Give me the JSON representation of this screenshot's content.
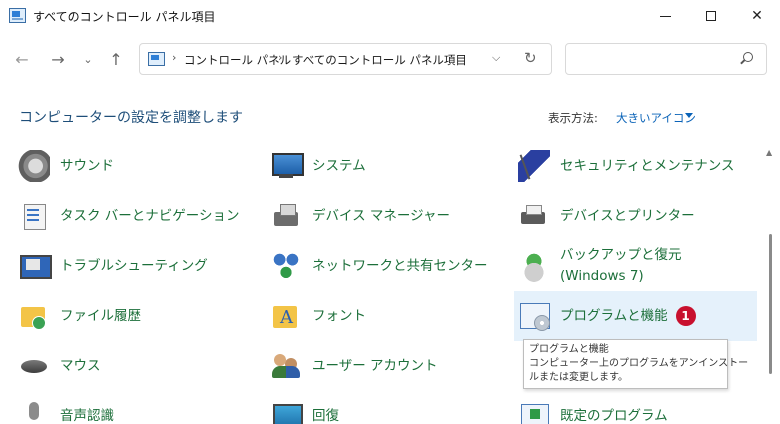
{
  "window": {
    "title": "すべてのコントロール パネル項目"
  },
  "nav": {
    "back_icon": "arrow-left",
    "forward_icon": "arrow-right",
    "recent_icon": "chevron-down",
    "up_icon": "arrow-up"
  },
  "address": {
    "crumbs": [
      "コントロール パネル",
      "すべてのコントロール パネル項目"
    ],
    "separator": "›"
  },
  "search": {
    "placeholder": ""
  },
  "content": {
    "heading": "コンピューターの設定を調整します",
    "view_by_label": "表示方法:",
    "view_by_value": "大きいアイコン"
  },
  "items": [
    {
      "label": "サウンド",
      "icon": "speaker-icon"
    },
    {
      "label": "システム",
      "icon": "monitor-icon"
    },
    {
      "label": "セキュリティとメンテナンス",
      "icon": "flag-icon"
    },
    {
      "label": "タスク バーとナビゲーション",
      "icon": "taskbar-icon"
    },
    {
      "label": "デバイス マネージャー",
      "icon": "device-manager-icon"
    },
    {
      "label": "デバイスとプリンター",
      "icon": "printer-icon"
    },
    {
      "label": "トラブルシューティング",
      "icon": "troubleshoot-icon"
    },
    {
      "label": "ネットワークと共有センター",
      "icon": "network-icon"
    },
    {
      "label": "バックアップと復元",
      "label2": "(Windows 7)",
      "icon": "backup-icon"
    },
    {
      "label": "ファイル履歴",
      "icon": "file-history-icon"
    },
    {
      "label": "フォント",
      "icon": "font-icon"
    },
    {
      "label": "プログラムと機能",
      "icon": "programs-icon",
      "badge": "1"
    },
    {
      "label": "マウス",
      "icon": "mouse-icon"
    },
    {
      "label": "ユーザー アカウント",
      "icon": "users-icon"
    },
    {
      "label": "音声認識",
      "icon": "microphone-icon"
    },
    {
      "label": "回復",
      "icon": "recovery-icon"
    },
    {
      "label": "既定のプログラム",
      "icon": "default-programs-icon"
    }
  ],
  "tooltip": {
    "title": "プログラムと機能",
    "line1": "コンピューター上のプログラムをアンインストー",
    "line2": "ルまたは変更します。"
  },
  "colors": {
    "link_green": "#1c6f3a",
    "heading_blue": "#1e4e79",
    "accent_blue": "#0a63b8",
    "highlight_bg": "#e5f1fb",
    "badge_red": "#c8102e"
  }
}
